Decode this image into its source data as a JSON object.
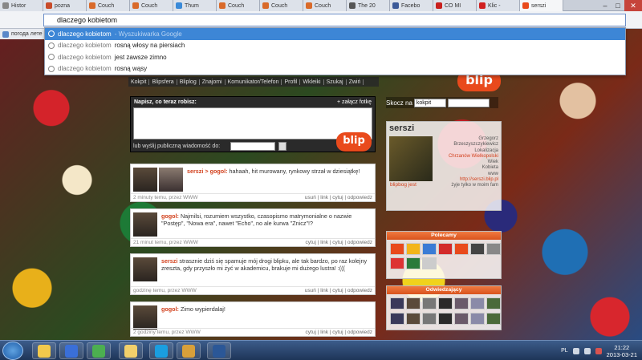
{
  "browser": {
    "tabs": [
      {
        "label": "Histor",
        "color": "#888888"
      },
      {
        "label": "pozna",
        "color": "#c84b2a"
      },
      {
        "label": "Couch",
        "color": "#d96a2a"
      },
      {
        "label": "Couch",
        "color": "#d96a2a"
      },
      {
        "label": "Thum",
        "color": "#3a8ad8"
      },
      {
        "label": "Couch",
        "color": "#d96a2a"
      },
      {
        "label": "Couch",
        "color": "#d96a2a"
      },
      {
        "label": "Couch",
        "color": "#d96a2a"
      },
      {
        "label": "The 20",
        "color": "#555555"
      },
      {
        "label": "Facebo",
        "color": "#3b5998"
      },
      {
        "label": "CO MI",
        "color": "#c8201e"
      },
      {
        "label": "Klic -",
        "color": "#d02020"
      },
      {
        "label": "serszi",
        "color": "#e94a1c"
      }
    ],
    "omnibox_value": "dlaczego kobietom",
    "bookmark_label": "погода лете",
    "suggestions": [
      {
        "query": "dlaczego kobietom",
        "rest": "",
        "hint": "- Wyszukiwarka Google"
      },
      {
        "query": "dlaczego kobietom",
        "rest": "rosną włosy na piersiach",
        "hint": ""
      },
      {
        "query": "dlaczego kobietom",
        "rest": "jest zawsze zimno",
        "hint": ""
      },
      {
        "query": "dlaczego kobietom",
        "rest": "rosną wąsy",
        "hint": ""
      }
    ]
  },
  "blip": {
    "logo": "blip",
    "nav": [
      "Kokpit",
      "Blipsfera",
      "Bliplog",
      "Znajomi",
      "Komunikator/Telefon",
      "Profil",
      "Wkleiki",
      "Szukaj",
      "Zwiń"
    ],
    "compose": {
      "title": "Napisz, co teraz robisz:",
      "attach": "+ załącz fotkę",
      "pm_label": "lub wyślij publiczną wiadomość do:"
    },
    "posts": [
      {
        "author": "serszi",
        "arrow": "> gogol:",
        "text": "hahaah, hit murowany, rynkowy strzał w dziesiątkę!",
        "time": "2 minuty temu, przez WWW",
        "actions": "usuń | link | cytuj | odpowiedz"
      },
      {
        "author": "gogol:",
        "arrow": "",
        "text": "Najmilsi, rozumiem wszystko, czasopismo matrymonialne o nazwie \"Postęp\", \"Nowa era\", nawet \"Echo\", no ale kurwa \"Znicz\"!?",
        "time": "21 minut temu, przez WWW",
        "actions": "cytuj | link | cytuj | odpowiedz"
      },
      {
        "author": "serszi",
        "arrow": "",
        "text": "strasznie dziś się spamuje mój drogi blipku, ale tak bardzo, po raz kolejny zreszta, gdy przyszło mi żyć w akademicu, brakuje mi dużego lustra! :(((",
        "time": "godzinę temu, przez WWW",
        "actions": "usuń | link | cytuj | odpowiedz"
      },
      {
        "author": "gogol:",
        "arrow": "",
        "text": "Zimo wypierdalaj!",
        "time": "2 godziny temu, przez WWW",
        "actions": "cytuj | link | cytuj | odpowiedz"
      }
    ],
    "jump": {
      "label": "Skocz na",
      "selected": "kokpit"
    },
    "profile": {
      "name": "serszi",
      "link": "blipbog jest",
      "meta": [
        "Grzegorz",
        "Brzeszyszczykiewicz",
        "Lokalizacja",
        "Chrzanów Wielkopolski",
        "Wiek",
        "Kobieta",
        "www",
        "http://serszi.blip.pl",
        "żyje tylko w moim fam"
      ]
    },
    "recommended_title": "Polecamy",
    "visitors_title": "Odwiedzający"
  },
  "taskbar": {
    "lang": "PL",
    "time": "21:22",
    "date": "2013-03-21"
  },
  "colors": {
    "accent": "#e94a1c",
    "selection": "#3d86d6"
  }
}
